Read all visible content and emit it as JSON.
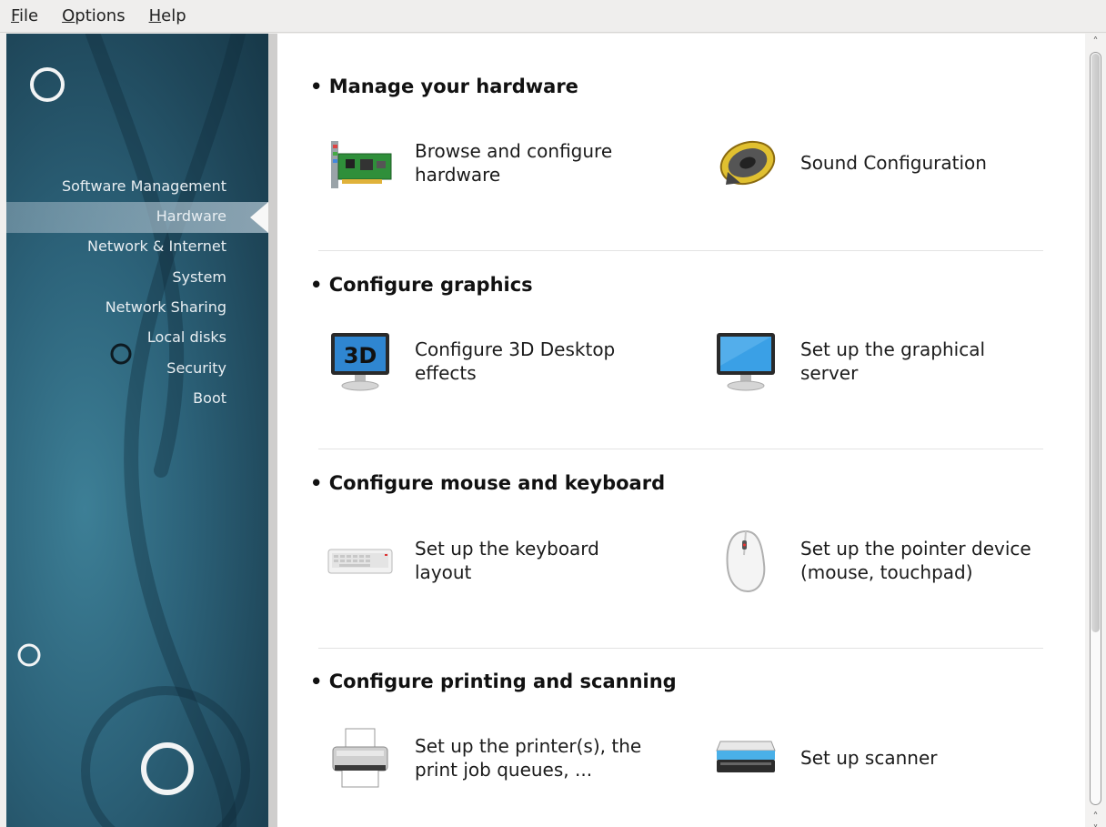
{
  "menubar": {
    "items": [
      {
        "label": "File",
        "mnemonic": "F",
        "rest": "ile"
      },
      {
        "label": "Options",
        "mnemonic": "O",
        "rest": "ptions"
      },
      {
        "label": "Help",
        "mnemonic": "H",
        "rest": "elp"
      }
    ]
  },
  "sidebar": {
    "items": [
      "Software Management",
      "Hardware",
      "Network & Internet",
      "System",
      "Network Sharing",
      "Local disks",
      "Security",
      "Boot"
    ],
    "selected": "Hardware"
  },
  "sections": [
    {
      "title": "Manage your hardware",
      "items": [
        {
          "label": "Browse and configure hardware",
          "icon": "pci-card-icon"
        },
        {
          "label": "Sound Configuration",
          "icon": "speaker-icon"
        }
      ]
    },
    {
      "title": "Configure graphics",
      "items": [
        {
          "label": "Configure 3D Desktop effects",
          "icon": "monitor-3d-icon",
          "icon_text": "3D"
        },
        {
          "label": "Set up the graphical server",
          "icon": "monitor-icon"
        }
      ]
    },
    {
      "title": "Configure mouse and keyboard",
      "items": [
        {
          "label": "Set up the keyboard layout",
          "icon": "keyboard-icon"
        },
        {
          "label": "Set up the pointer device (mouse, touchpad)",
          "icon": "mouse-icon"
        }
      ]
    },
    {
      "title": "Configure printing and scanning",
      "items": [
        {
          "label": "Set up the printer(s), the print job queues, ...",
          "icon": "printer-icon"
        },
        {
          "label": "Set up scanner",
          "icon": "scanner-icon"
        }
      ]
    }
  ],
  "scrollbar": {
    "up_icon": "chevron-up-icon",
    "down_icon": "chevron-down-icon"
  }
}
